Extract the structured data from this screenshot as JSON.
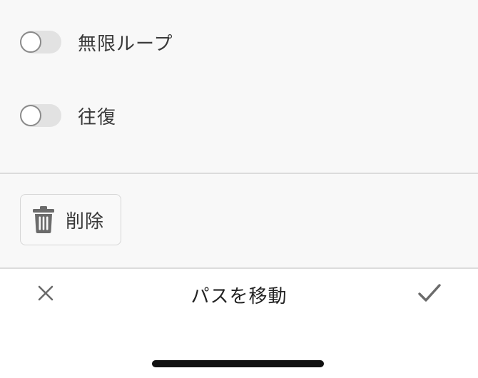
{
  "options": {
    "infinite_loop": {
      "label": "無限ループ",
      "enabled": false
    },
    "round_trip": {
      "label": "往復",
      "enabled": false
    }
  },
  "actions": {
    "delete_label": "削除",
    "delete_icon": "trash-icon"
  },
  "toolbar": {
    "title": "パスを移動",
    "cancel_icon": "close-icon",
    "confirm_icon": "checkmark-icon"
  },
  "colors": {
    "panel_background": "#f8f8f8",
    "switch_off_track": "#e2e2e2",
    "switch_knob_border": "#8a8a8a",
    "icon_gray": "#6b6b6b",
    "home_indicator": "#111111"
  }
}
